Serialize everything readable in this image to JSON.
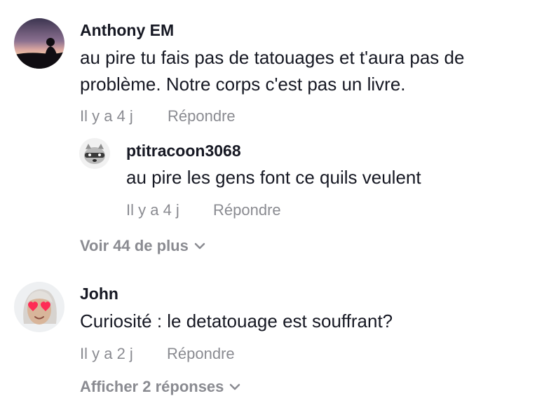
{
  "comments": [
    {
      "username": "Anthony EM",
      "text": "au pire tu fais pas de tatouages et t'aura pas de problème. Notre corps c'est pas un livre.",
      "time": "Il y a 4 j",
      "reply_label": "Répondre",
      "avatar_icon": "sunset-silhouette-avatar",
      "replies": [
        {
          "username": "ptitracoon3068",
          "text": "au pire les gens font ce quils veulent",
          "time": "Il y a 4 j",
          "reply_label": "Répondre",
          "avatar_icon": "raccoon-avatar"
        }
      ],
      "view_more": "Voir 44 de plus"
    },
    {
      "username": "John",
      "text": "Curiosité : le detatouage est souffrant?",
      "time": "Il y a 2 j",
      "reply_label": "Répondre",
      "avatar_icon": "heart-eyes-avatar",
      "view_more": "Afficher 2 réponses"
    }
  ],
  "colors": {
    "text": "#161823",
    "muted": "#8a8b91",
    "heart": "#fe2c55"
  }
}
